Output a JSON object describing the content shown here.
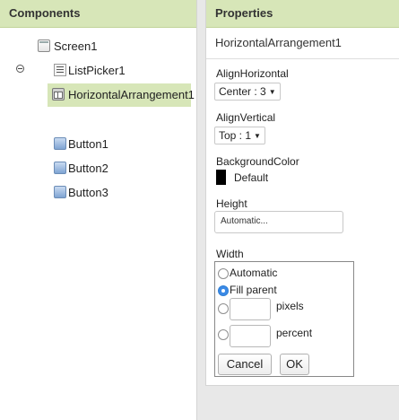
{
  "components": {
    "header": "Components",
    "screen": {
      "label": "Screen1",
      "icon": "screen-icon"
    },
    "children": [
      {
        "label": "ListPicker1",
        "icon": "listpicker-icon"
      },
      {
        "label": "HorizontalArrangement1",
        "icon": "horizontal-arrangement-icon",
        "selected": true
      },
      {
        "label": "Button1",
        "icon": "button-icon"
      },
      {
        "label": "Button2",
        "icon": "button-icon"
      },
      {
        "label": "Button3",
        "icon": "button-icon"
      }
    ]
  },
  "properties": {
    "header": "Properties",
    "component_name": "HorizontalArrangement1",
    "align_horizontal": {
      "label": "AlignHorizontal",
      "value": "Center : 3"
    },
    "align_vertical": {
      "label": "AlignVertical",
      "value": "Top : 1"
    },
    "background_color": {
      "label": "BackgroundColor",
      "value": "Default",
      "swatch": "#000000"
    },
    "height": {
      "label": "Height",
      "value": "Automatic..."
    },
    "width": {
      "label": "Width",
      "options": {
        "automatic": "Automatic",
        "fill_parent": "Fill parent",
        "pixels": "pixels",
        "percent": "percent"
      },
      "selected": "Fill parent",
      "cancel": "Cancel",
      "ok": "OK"
    }
  },
  "colors": {
    "header_bg": "#d7e6b8",
    "selection_bg": "#d7e6b8",
    "radio_checked": "#3b8ae6"
  }
}
